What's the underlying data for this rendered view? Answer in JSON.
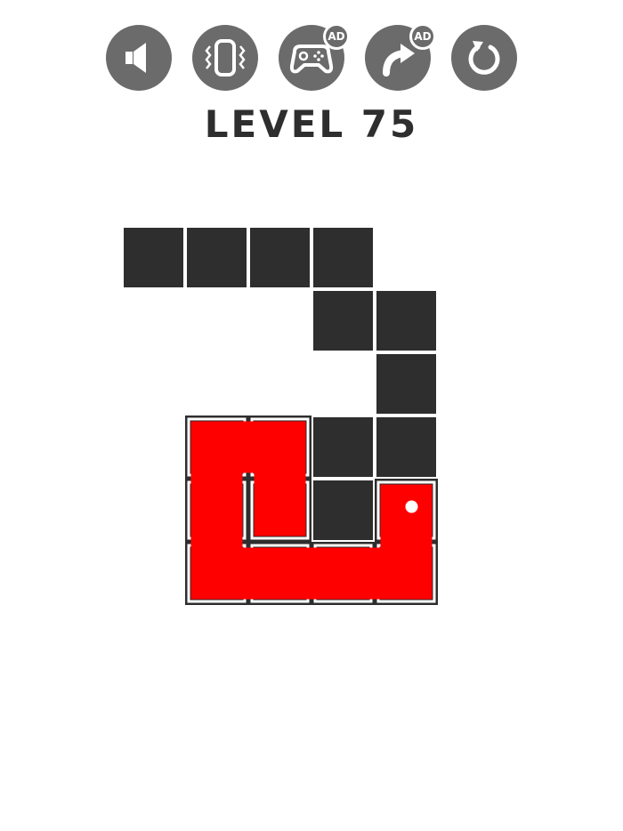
{
  "toolbar": {
    "buttons": [
      {
        "name": "sound-button",
        "icon": "speaker-icon",
        "ad": false
      },
      {
        "name": "vibration-button",
        "icon": "vibration-icon",
        "ad": false
      },
      {
        "name": "more-games-button",
        "icon": "gamepad-icon",
        "ad": true,
        "ad_label": "AD"
      },
      {
        "name": "skip-level-button",
        "icon": "skip-arrow-icon",
        "ad": true,
        "ad_label": "AD"
      },
      {
        "name": "restart-button",
        "icon": "restart-icon",
        "ad": false
      }
    ]
  },
  "level": {
    "title": "LEVEL 75",
    "number": 75
  },
  "board": {
    "columns": 6,
    "rows": 6,
    "empty_cells": [
      [
        0,
        0
      ],
      [
        0,
        1
      ],
      [
        0,
        2
      ],
      [
        0,
        3
      ],
      [
        1,
        3
      ],
      [
        1,
        4
      ],
      [
        2,
        4
      ],
      [
        3,
        2
      ],
      [
        3,
        3
      ],
      [
        3,
        4
      ],
      [
        4,
        3
      ]
    ],
    "snake_path": [
      [
        4,
        4
      ],
      [
        5,
        4
      ],
      [
        5,
        3
      ],
      [
        5,
        2
      ],
      [
        5,
        1
      ],
      [
        4,
        1
      ],
      [
        3,
        1
      ],
      [
        3,
        2
      ],
      [
        4,
        2
      ]
    ],
    "snake_head": [
      4,
      4
    ]
  },
  "colors": {
    "background": "#ffffff",
    "button": "#6b6b6b",
    "cell": "#2e2e2e",
    "snake": "#ff0000",
    "snake_head_dot": "#ffffff",
    "title": "#2e2e2e"
  }
}
